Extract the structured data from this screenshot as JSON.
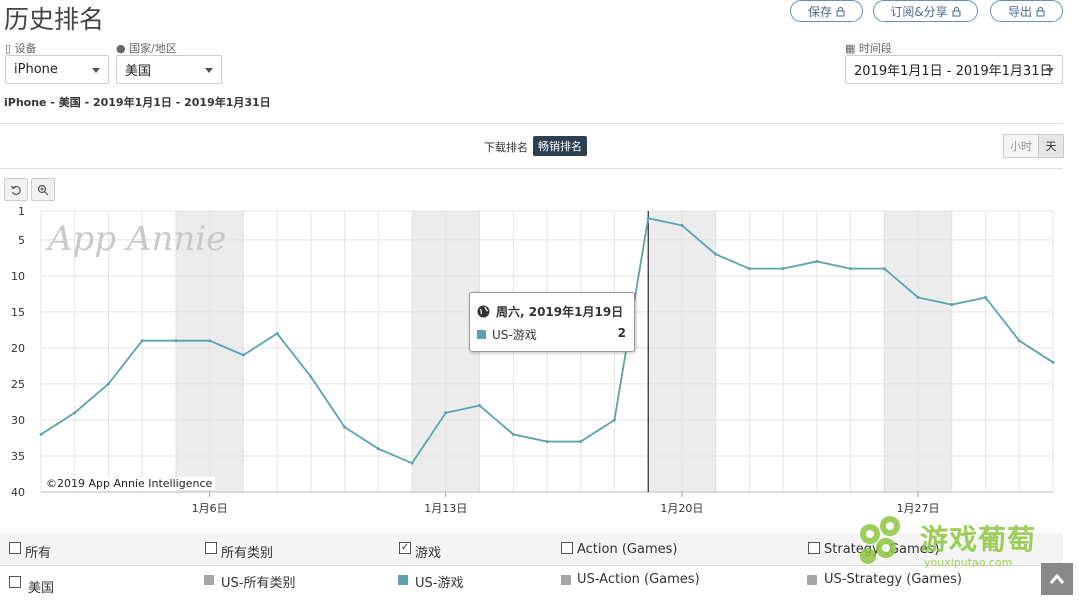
{
  "page_title": "历史排名",
  "actions": {
    "save": "保存",
    "subscribe": "订阅&分享",
    "export": "导出"
  },
  "filters": {
    "device_label": "设备",
    "device_value": "iPhone",
    "country_label": "国家/地区",
    "country_value": "美国",
    "period_label": "时间段",
    "period_value": "2019年1月1日 - 2019年1月31日"
  },
  "breadcrumb": "iPhone - 美国 - 2019年1月1日 - 2019年1月31日",
  "rank_toggle": {
    "download": "下载排名",
    "grossing": "畅销排名"
  },
  "granularity": {
    "hour": "小时",
    "day": "天"
  },
  "watermark": "App Annie",
  "copyright": "©2019 App Annie Intelligence",
  "tooltip": {
    "date": "周六, 2019年1月19日",
    "series": "US-游戏",
    "value": "2"
  },
  "legend": {
    "row1": [
      "所有",
      "所有类别",
      "游戏",
      "Action (Games)",
      "Strategy (Games)"
    ],
    "row2_country": "美国",
    "row2": [
      "US-所有类别",
      "US-游戏",
      "US-Action (Games)",
      "US-Strategy (Games)"
    ]
  },
  "site_watermark": {
    "name": "游戏葡萄",
    "url": "youxiputao.com"
  },
  "colors": {
    "series": "#5aa3ad",
    "weekend": "#ececec",
    "grid": "#e3e3e3",
    "chip": "#2b3f52"
  },
  "chart_data": {
    "type": "line",
    "x_tick_labels": [
      "1月6日",
      "1月13日",
      "1月20日",
      "1月27日"
    ],
    "x": [
      1,
      2,
      3,
      4,
      5,
      6,
      7,
      8,
      9,
      10,
      11,
      12,
      13,
      14,
      15,
      16,
      17,
      18,
      19,
      20,
      21,
      22,
      23,
      24,
      25,
      26,
      27,
      28,
      29,
      30,
      31
    ],
    "series": [
      {
        "name": "US-游戏",
        "values": [
          32,
          29,
          25,
          19,
          19,
          19,
          21,
          18,
          24,
          31,
          34,
          36,
          29,
          28,
          32,
          33,
          33,
          30,
          2,
          3,
          7,
          9,
          9,
          8,
          9,
          9,
          13,
          14,
          13,
          19,
          22
        ]
      }
    ],
    "y_ticks": [
      1,
      5,
      10,
      15,
      20,
      25,
      30,
      35,
      40
    ],
    "ylim": [
      1,
      40
    ],
    "y_reversed": true,
    "highlighted_day": 19,
    "grid": true
  }
}
